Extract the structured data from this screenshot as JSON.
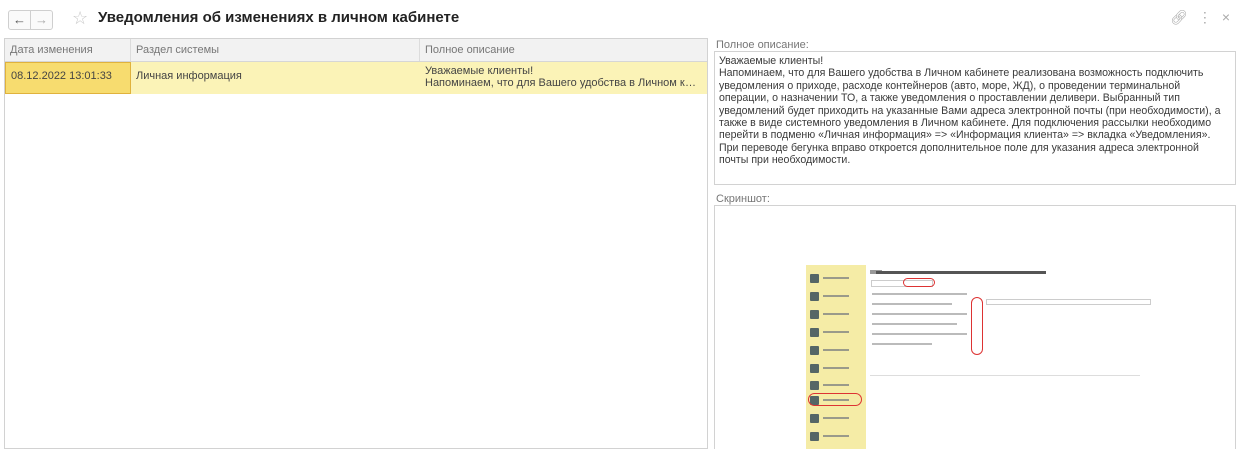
{
  "window": {
    "title": "Уведомления об изменениях в личном кабинете",
    "icons": {
      "back": "arrow-left-icon",
      "forward": "arrow-right-icon",
      "favorite": "star-icon",
      "link": "link-icon",
      "more": "more-vertical-icon",
      "close": "close-icon"
    }
  },
  "table": {
    "columns": [
      "Дата изменения",
      "Раздел системы",
      "Полное описание"
    ],
    "rows": [
      {
        "date": "08.12.2022 13:01:33",
        "section": "Личная информация",
        "description_line1": "Уважаемые клиенты!",
        "description_line2": "Напоминаем, что для Вашего удобства в Личном кабинете реализована возможность подключить уведомления"
      }
    ]
  },
  "details": {
    "description_label": "Полное описание:",
    "description_text": "Уважаемые клиенты!\nНапоминаем, что для Вашего удобства в Личном кабинете реализована возможность подключить уведомления о приходе, расходе контейнеров (авто, море, ЖД), о проведении терминальной операции, о назначении ТО, а также уведомления о проставлении деливери. Выбранный тип уведомлений будет приходить на указанные Вами адреса электронной почты (при необходимости), а также в виде системного уведомления в Личном кабинете. Для подключения рассылки необходимо перейти в подменю «Личная информация» => «Информация клиента» => вкладка «Уведомления». При переводе бегунка вправо откроется дополнительное поле для указания адреса электронной почты при необходимости.",
    "screenshot_label": "Скриншот:"
  },
  "colors": {
    "selected_row": "#fbf3b7",
    "selected_cell": "#f7dc6f",
    "annotation_red": "#dd3333"
  }
}
